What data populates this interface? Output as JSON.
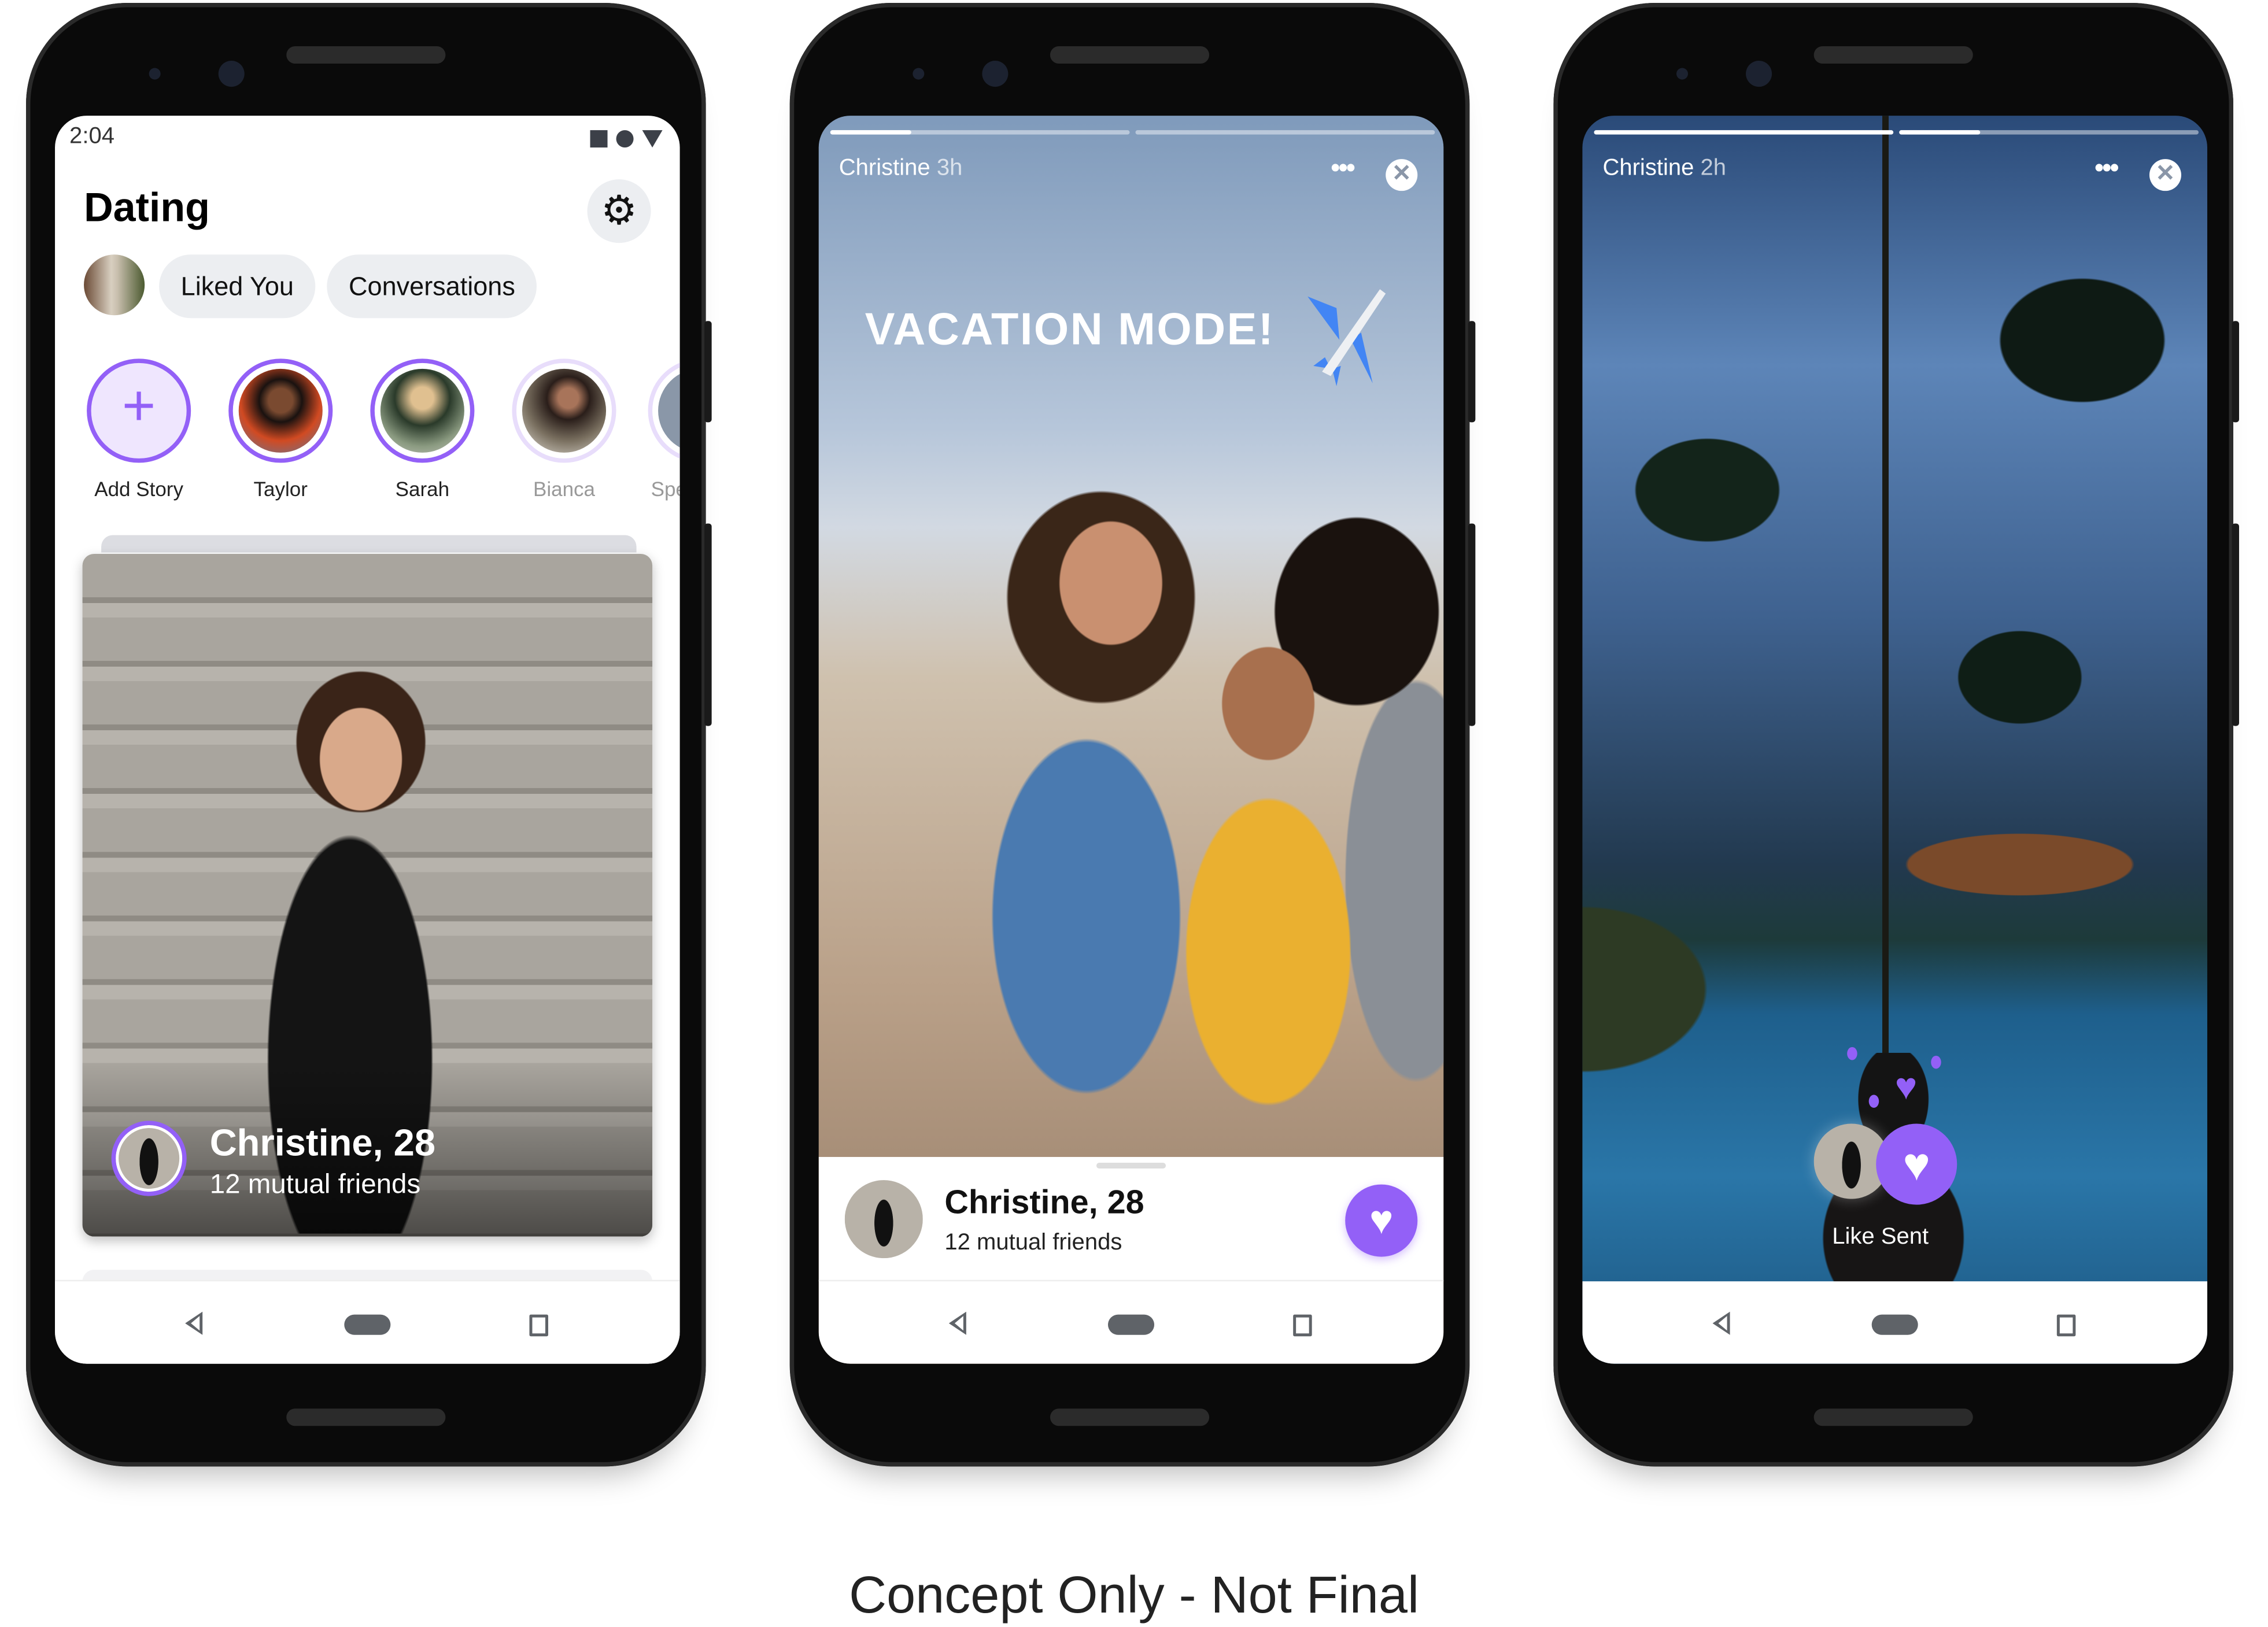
{
  "colors": {
    "accent": "#9360f7",
    "chip_bg": "#eceef1",
    "nav_icon": "#5f6368",
    "plane_blue": "#4285f4"
  },
  "phone1": {
    "status": {
      "time": "2:04",
      "icons": [
        "square-icon",
        "circle-icon",
        "triangle-icon"
      ]
    },
    "title": "Dating",
    "settings_icon": "gear-icon",
    "chips": [
      "Liked You",
      "Conversations"
    ],
    "stories": [
      {
        "name": "Add Story",
        "icon": "plus-icon",
        "seen": false
      },
      {
        "name": "Taylor",
        "seen": false
      },
      {
        "name": "Sarah",
        "seen": false
      },
      {
        "name": "Bianca",
        "seen": true
      },
      {
        "name": "Spe",
        "seen": true
      }
    ],
    "card": {
      "name_age": "Christine, 28",
      "mutual": "12 mutual friends"
    }
  },
  "phone2": {
    "story_user": "Christine",
    "story_age": "3h",
    "progress": [
      0.27,
      0
    ],
    "sticker_text": "VACATION MODE!",
    "sticker_icon": "airplane-icon",
    "card": {
      "name_age": "Christine, 28",
      "mutual": "12 mutual friends",
      "like_icon": "heart-icon"
    }
  },
  "phone3": {
    "story_user": "Christine",
    "story_age": "2h",
    "progress": [
      1,
      0.27
    ],
    "like_sent": "Like Sent"
  },
  "caption": "Concept Only - Not Final"
}
